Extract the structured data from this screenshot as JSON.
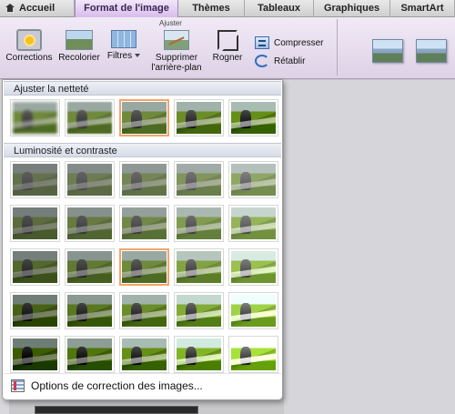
{
  "tabs": [
    {
      "label": "Accueil",
      "active": false
    },
    {
      "label": "Format de l'image",
      "active": true
    },
    {
      "label": "Thèmes",
      "active": false
    },
    {
      "label": "Tableaux",
      "active": false
    },
    {
      "label": "Graphiques",
      "active": false
    },
    {
      "label": "SmartArt",
      "active": false
    }
  ],
  "ribbon": {
    "group_label": "Ajuster",
    "corrections_label": "Corrections",
    "recolor_label": "Recolorier",
    "filters_label": "Filtres",
    "remove_bg_label_1": "Supprimer",
    "remove_bg_label_2": "l'arrière-plan",
    "crop_label": "Rogner",
    "compress_label": "Compresser",
    "reset_label": "Rétablir"
  },
  "gallery": {
    "sharpness_heading": "Ajuster la netteté",
    "brightness_heading": "Luminosité et contraste",
    "options_label": "Options de correction des images...",
    "sharpness_selected_index": 2,
    "brightness_selected": {
      "row": 2,
      "col": 2
    },
    "sharpness_count": 5,
    "brightness_rows": 5,
    "brightness_cols": 5
  },
  "colors": {
    "active_tab": "#d7bdea",
    "ribbon_bg": "#e8dff0",
    "selection_border": "#f4a46a"
  }
}
